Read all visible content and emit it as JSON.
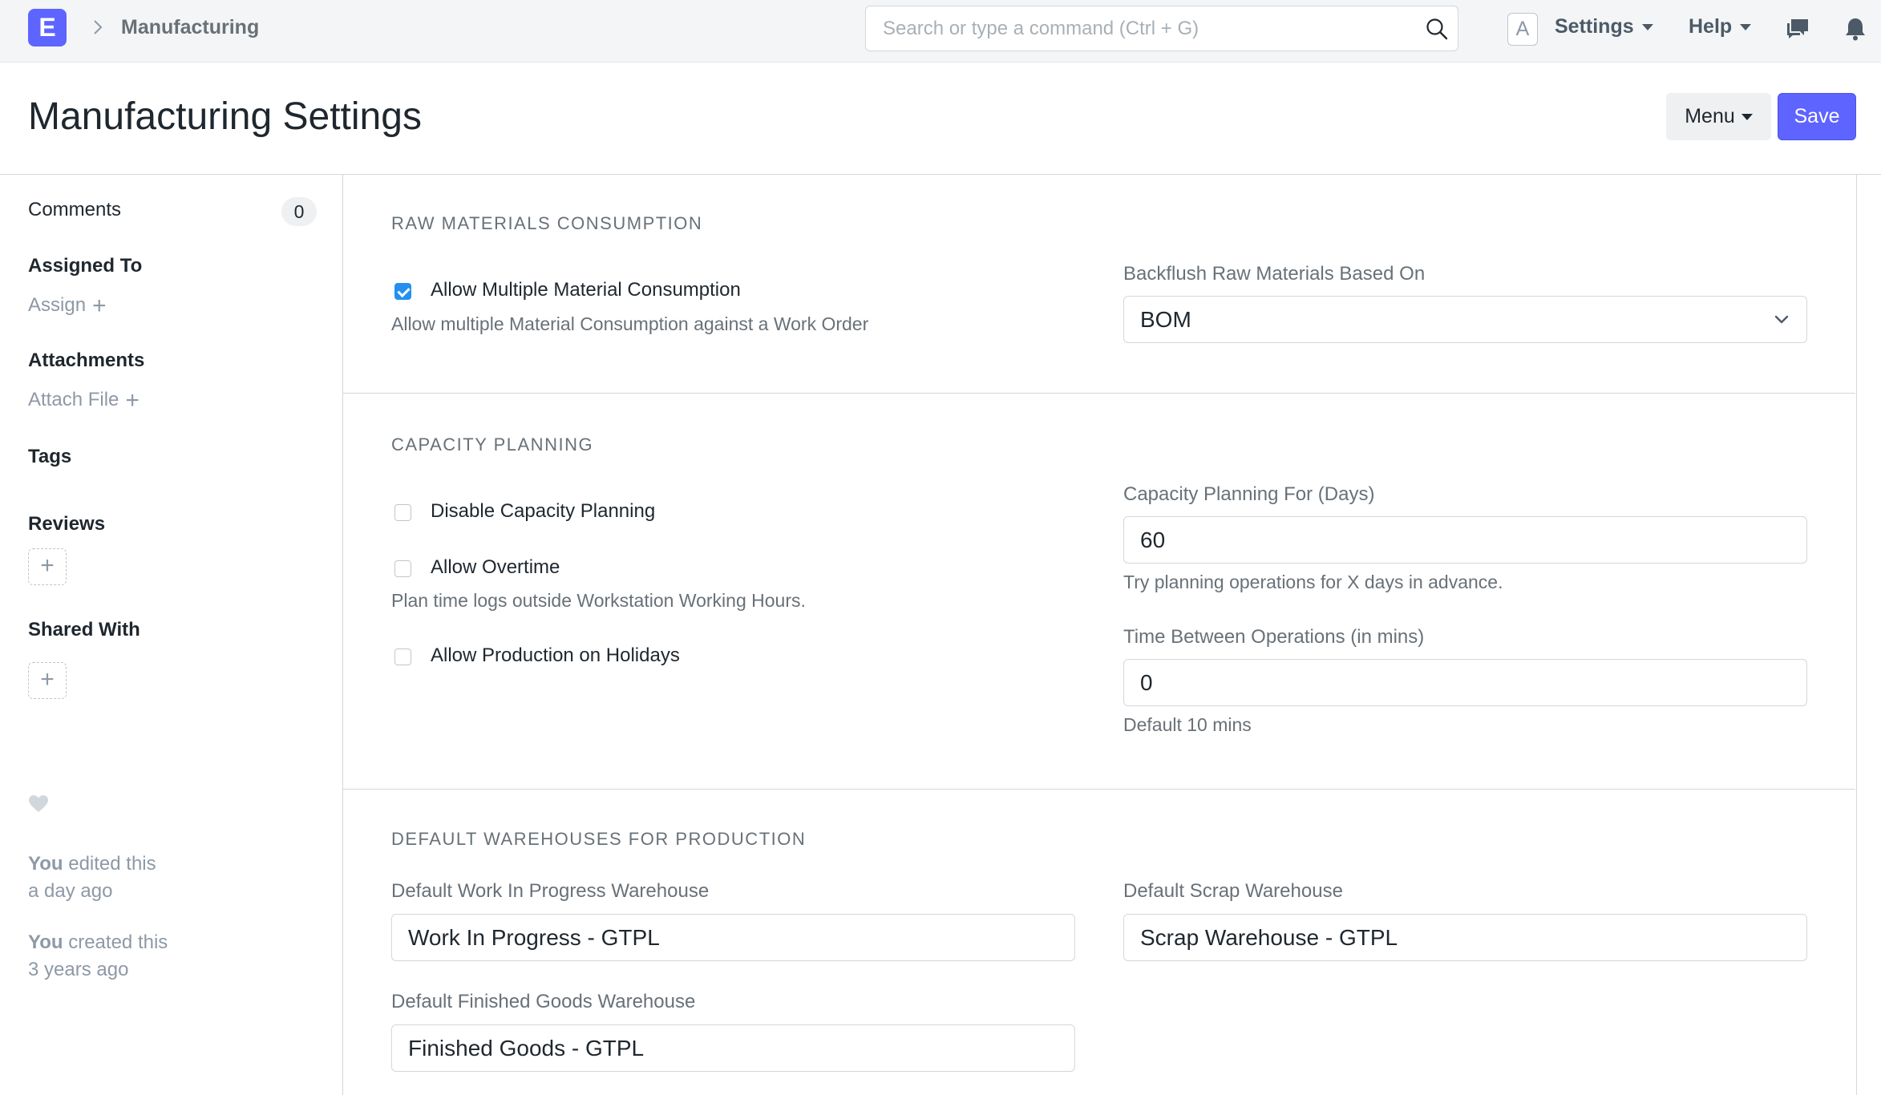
{
  "navbar": {
    "logo_letter": "E",
    "breadcrumb": "Manufacturing",
    "search_placeholder": "Search or type a command (Ctrl + G)",
    "avatar_letter": "A",
    "settings_label": "Settings",
    "help_label": "Help",
    "icons": [
      "chevron-right-icon",
      "search-icon",
      "chat-icon",
      "bell-icon"
    ]
  },
  "page": {
    "title": "Manufacturing Settings",
    "menu_label": "Menu",
    "save_label": "Save"
  },
  "sidebar": {
    "comments_label": "Comments",
    "comments_count": "0",
    "assigned_to_label": "Assigned To",
    "assign_label": "Assign",
    "attachments_label": "Attachments",
    "attach_file_label": "Attach File",
    "tags_label": "Tags",
    "reviews_label": "Reviews",
    "shared_with_label": "Shared With",
    "activity": [
      {
        "who": "You",
        "action": "edited this",
        "when": "a day ago"
      },
      {
        "who": "You",
        "action": "created this",
        "when": "3 years ago"
      }
    ]
  },
  "sections": {
    "raw_materials": {
      "title": "RAW MATERIALS CONSUMPTION",
      "allow_multiple_label": "Allow Multiple Material Consumption",
      "allow_multiple_checked": true,
      "allow_multiple_help": "Allow multiple Material Consumption against a Work Order",
      "backflush_label": "Backflush Raw Materials Based On",
      "backflush_value": "BOM"
    },
    "capacity": {
      "title": "CAPACITY PLANNING",
      "disable_label": "Disable Capacity Planning",
      "disable_checked": false,
      "overtime_label": "Allow Overtime",
      "overtime_checked": false,
      "overtime_help": "Plan time logs outside Workstation Working Hours.",
      "holidays_label": "Allow Production on Holidays",
      "holidays_checked": false,
      "days_label": "Capacity Planning For (Days)",
      "days_value": "60",
      "days_help": "Try planning operations for X days in advance.",
      "time_between_label": "Time Between Operations (in mins)",
      "time_between_value": "0",
      "time_between_help": "Default 10 mins"
    },
    "warehouses": {
      "title": "DEFAULT WAREHOUSES FOR PRODUCTION",
      "wip_label": "Default Work In Progress Warehouse",
      "wip_value": "Work In Progress - GTPL",
      "scrap_label": "Default Scrap Warehouse",
      "scrap_value": "Scrap Warehouse - GTPL",
      "fg_label": "Default Finished Goods Warehouse",
      "fg_value": "Finished Goods - GTPL"
    }
  },
  "colors": {
    "primary": "#5e64ff",
    "checkbox_checked": "#2490ef",
    "muted_text": "#687178"
  }
}
